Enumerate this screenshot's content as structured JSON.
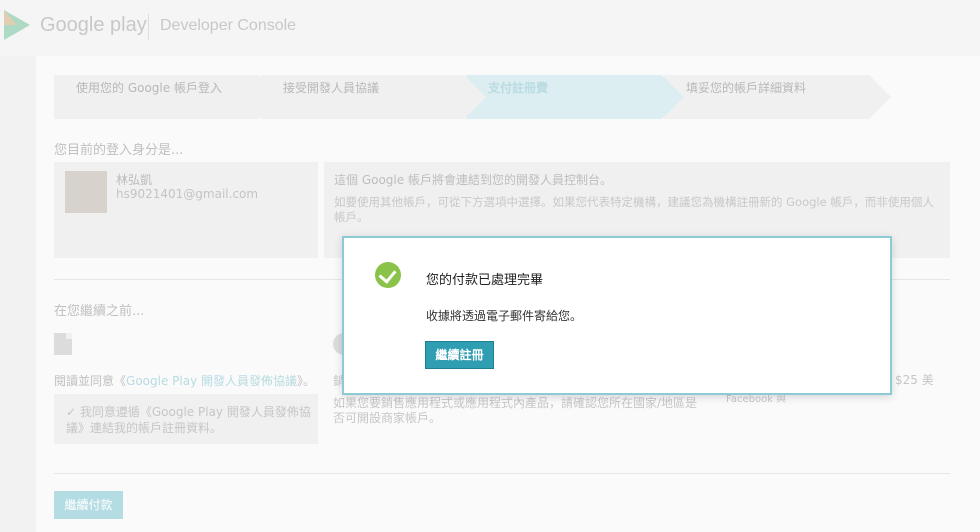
{
  "header": {
    "brand": "Google play",
    "product": "Developer Console"
  },
  "steps": [
    {
      "label": "使用您的 Google 帳戶登入"
    },
    {
      "label": "接受開發人員協議"
    },
    {
      "label": "支付註冊費"
    },
    {
      "label": "填妥您的帳戶詳細資料"
    }
  ],
  "account": {
    "heading": "您目前的登入身分是...",
    "name": "林弘凱",
    "email": "hs9021401@gmail.com",
    "info_title": "這個 Google 帳戶將會連結到您的開發人員控制台。",
    "info_desc": "如要使用其他帳戶，可從下方選項中選擇。如果您代表特定機構，建議您為機構註冊新的 Google 帳戶，而非使用個人帳戶。"
  },
  "before": {
    "heading": "在您繼續之前...",
    "agree_prefix": "閱讀並同意《",
    "agree_link": "Google Play 開發人員發佈協議",
    "agree_suffix": "》。",
    "agree_check": "我同意遵循《Google Play 開發人員發佈協議》連結我的帳戶註冊資料。",
    "mid_text": "銷",
    "mid_desc": "如果您要銷售應用程式或應用程式內產品，請確認您所在國家/地區是否可開設商家帳戶。",
    "right_frag": "$25 美",
    "right_frag2": "Facebook 與"
  },
  "bottom_button": "繼續付款",
  "modal": {
    "title": "您的付款已處理完畢",
    "message": "收據將透過電子郵件寄給您。",
    "button": "繼續註冊"
  }
}
